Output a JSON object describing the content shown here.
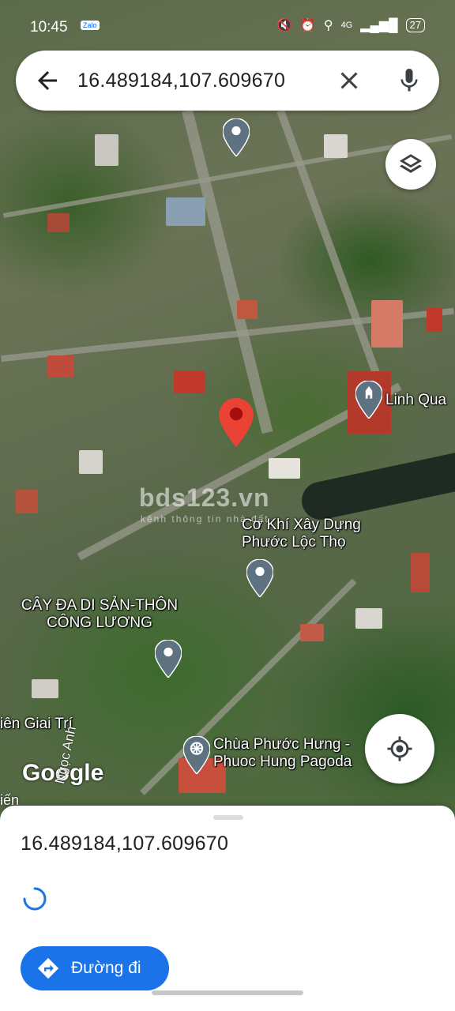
{
  "status_bar": {
    "time": "10:45",
    "app_badge": "Zalo",
    "network": "4G",
    "battery": "27"
  },
  "search": {
    "query": "16.489184,107.609670",
    "back_icon": "arrow-left-icon",
    "clear_icon": "close-icon",
    "mic_icon": "microphone-icon"
  },
  "map": {
    "places": [
      {
        "name_line1": "Linh Qua",
        "name_line2": ""
      },
      {
        "name_line1": "Cơ Khí Xây Dựng",
        "name_line2": "Phước Lộc Thọ"
      },
      {
        "name_line1": "CÂY ĐA DI SẢN-THÔN",
        "name_line2": "CÔNG LƯƠNG"
      },
      {
        "name_line1": "Chùa Phước Hưng -",
        "name_line2": "Phuoc Hung Pagoda"
      },
      {
        "name_line1": "iên Giai Trí",
        "name_line2": ""
      }
    ],
    "watermark": "bds123.vn",
    "watermark_sub": "kênh thông tin nhà đất",
    "logo": "Google",
    "road_label": "Ngọc Anh",
    "road_label2": "iến"
  },
  "sheet": {
    "coordinates": "16.489184,107.609670",
    "directions_label": "Đường đi"
  },
  "colors": {
    "accent": "#1a73e8",
    "pin_red": "#ea4335",
    "pin_gray": "#5f7282"
  }
}
